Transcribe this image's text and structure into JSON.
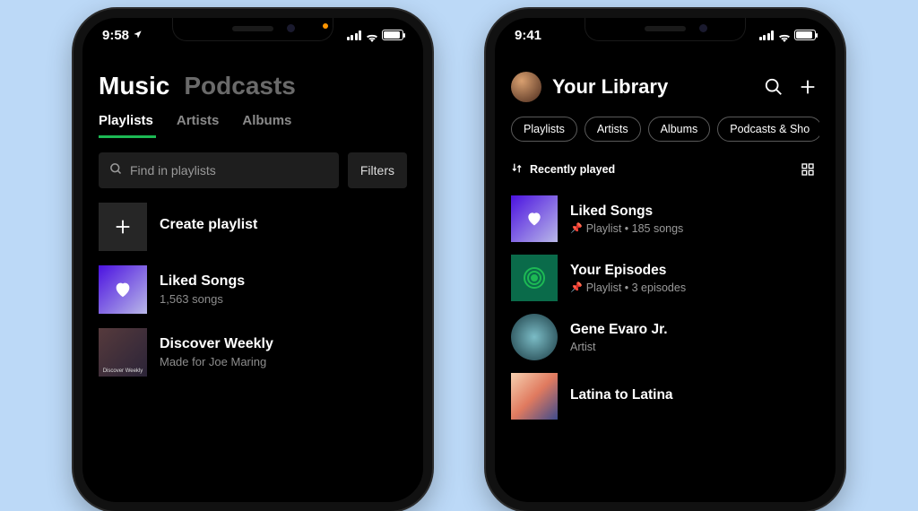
{
  "left_phone": {
    "time": "9:58",
    "top_tabs": {
      "music": "Music",
      "podcasts": "Podcasts"
    },
    "sub_tabs": {
      "playlists": "Playlists",
      "artists": "Artists",
      "albums": "Albums"
    },
    "search_placeholder": "Find in playlists",
    "filters_label": "Filters",
    "rows": {
      "create": {
        "title": "Create playlist"
      },
      "liked": {
        "title": "Liked Songs",
        "sub": "1,563 songs"
      },
      "discover": {
        "title": "Discover Weekly",
        "sub": "Made for Joe Maring",
        "thumb_text": "Discover Weekly"
      }
    }
  },
  "right_phone": {
    "time": "9:41",
    "header": {
      "title": "Your Library"
    },
    "chips": [
      "Playlists",
      "Artists",
      "Albums",
      "Podcasts & Sho"
    ],
    "sort_label": "Recently played",
    "rows": [
      {
        "title": "Liked Songs",
        "meta": "Playlist • 185 songs",
        "pinned": true,
        "kind": "liked"
      },
      {
        "title": "Your Episodes",
        "meta": "Playlist • 3 episodes",
        "pinned": true,
        "kind": "episodes"
      },
      {
        "title": "Gene Evaro Jr.",
        "meta": "Artist",
        "pinned": false,
        "kind": "artist"
      },
      {
        "title": "Latina to Latina",
        "meta": "",
        "pinned": false,
        "kind": "latina"
      }
    ]
  }
}
